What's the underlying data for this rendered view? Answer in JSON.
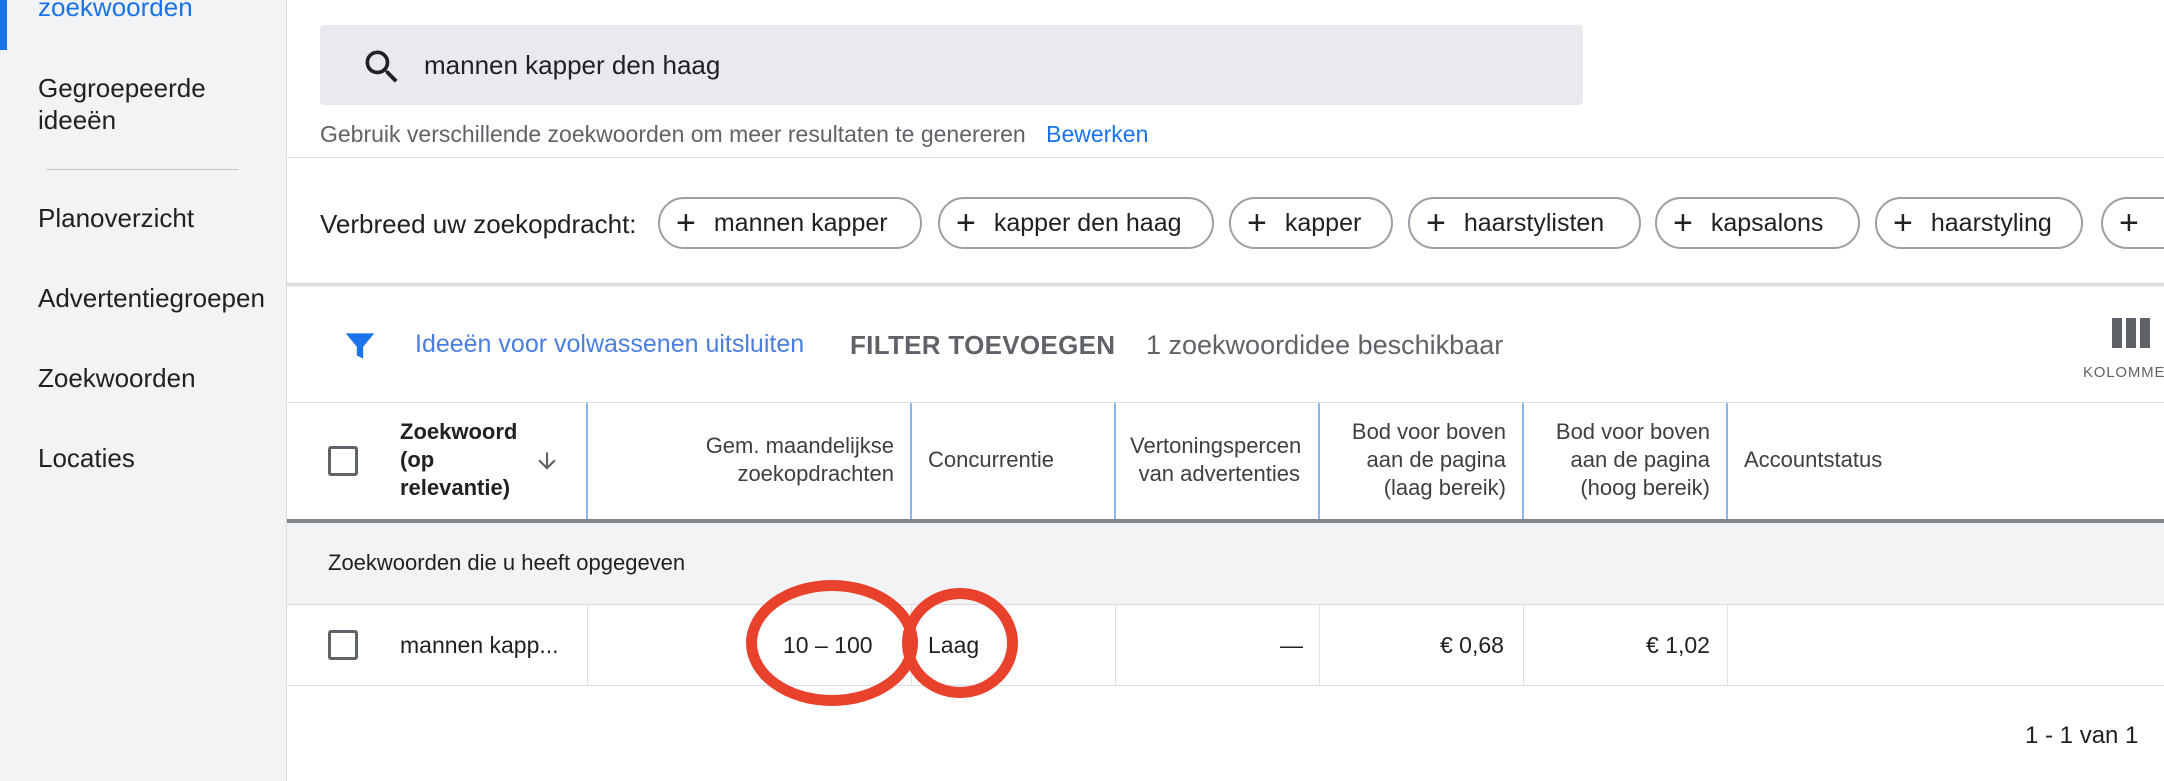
{
  "sidebar": {
    "items": [
      {
        "label": "zoekwoorden",
        "active": true
      },
      {
        "label": "Gegroepeerde ideeën",
        "active": false
      },
      {
        "label": "Planoverzicht",
        "active": false
      },
      {
        "label": "Advertentiegroepen",
        "active": false
      },
      {
        "label": "Zoekwoorden",
        "active": false
      },
      {
        "label": "Locaties",
        "active": false
      }
    ]
  },
  "search": {
    "query": "mannen kapper den haag",
    "icon": "search-icon",
    "hint": "Gebruik verschillende zoekwoorden om meer resultaten te genereren",
    "edit_label": "Bewerken"
  },
  "broaden": {
    "label": "Verbreed uw zoekopdracht:",
    "chips": [
      "mannen kapper",
      "kapper den haag",
      "kapper",
      "haarstylisten",
      "kapsalons",
      "haarstyling"
    ]
  },
  "filter_bar": {
    "exclude_adult": "Ideeën voor volwassenen uitsluiten",
    "add_filter": "FILTER TOEVOEGEN",
    "count": "1 zoekwoordidee beschikbaar",
    "columns_label": "KOLOMMEN"
  },
  "table": {
    "headers": {
      "keyword": "Zoekwoord (op relevantie)",
      "avg_monthly": "Gem. maandelijkse zoekopdrachten",
      "competition": "Concurrentie",
      "impression_share": "Vertoningspercentage van advertenties",
      "bid_low": "Bod voor boven aan de pagina (laag bereik)",
      "bid_high": "Bod voor boven aan de pagina (hoog bereik)",
      "account_status": "Accountstatus"
    },
    "group_label": "Zoekwoorden die u heeft opgegeven",
    "rows": [
      {
        "keyword": "mannen kapp...",
        "avg_monthly": "10 – 100",
        "competition": "Laag",
        "impression_share": "—",
        "bid_low": "€ 0,68",
        "bid_high": "€ 1,02",
        "account_status": ""
      }
    ],
    "pagination": "1 - 1 van 1"
  },
  "colors": {
    "accent": "#1a73e8",
    "annotation": "#e8412c"
  }
}
